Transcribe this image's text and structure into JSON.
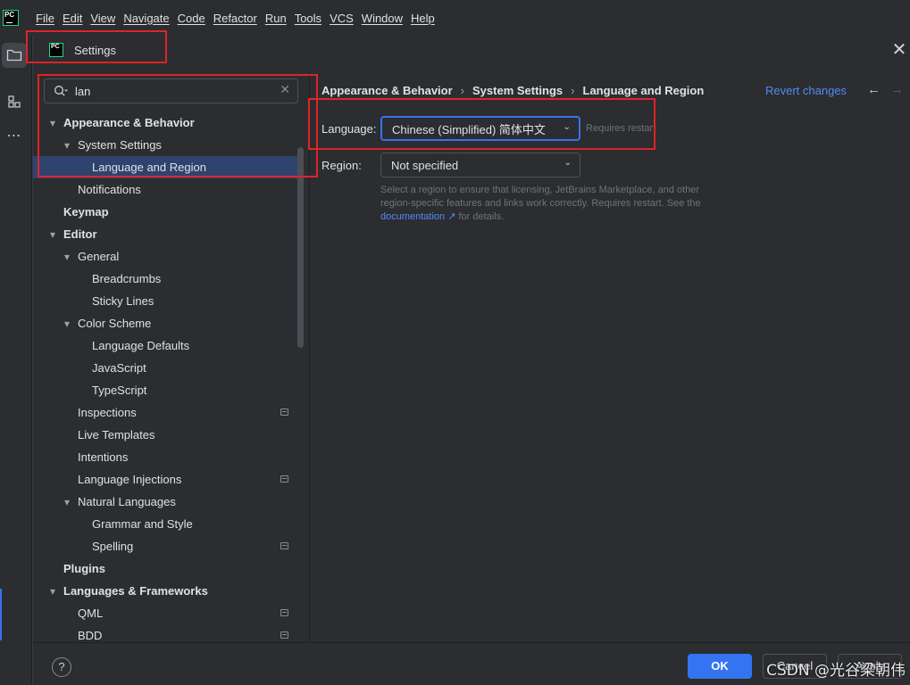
{
  "menubar": {
    "logo_text": "PC",
    "items": [
      "File",
      "Edit",
      "View",
      "Navigate",
      "Code",
      "Refactor",
      "Run",
      "Tools",
      "VCS",
      "Window",
      "Help"
    ]
  },
  "dialog": {
    "title": "Settings",
    "logo_text": "PC",
    "close_glyph": "✕"
  },
  "sidebar": {
    "search_value": "lan",
    "tree": [
      {
        "label": "Appearance & Behavior",
        "level": 0,
        "bold": true,
        "expander": "expanded"
      },
      {
        "label": "System Settings",
        "level": 1,
        "bold": false,
        "expander": "expanded"
      },
      {
        "label": "Language and Region",
        "level": 2,
        "bold": false,
        "expander": "none",
        "selected": true
      },
      {
        "label": "Notifications",
        "level": 1,
        "bold": false,
        "expander": "none"
      },
      {
        "label": "Keymap",
        "level": 0,
        "bold": true,
        "expander": "none"
      },
      {
        "label": "Editor",
        "level": 0,
        "bold": true,
        "expander": "expanded"
      },
      {
        "label": "General",
        "level": 1,
        "bold": false,
        "expander": "expanded"
      },
      {
        "label": "Breadcrumbs",
        "level": 2,
        "bold": false,
        "expander": "none"
      },
      {
        "label": "Sticky Lines",
        "level": 2,
        "bold": false,
        "expander": "none"
      },
      {
        "label": "Color Scheme",
        "level": 1,
        "bold": false,
        "expander": "expanded"
      },
      {
        "label": "Language Defaults",
        "level": 2,
        "bold": false,
        "expander": "none"
      },
      {
        "label": "JavaScript",
        "level": 2,
        "bold": false,
        "expander": "none"
      },
      {
        "label": "TypeScript",
        "level": 2,
        "bold": false,
        "expander": "none"
      },
      {
        "label": "Inspections",
        "level": 1,
        "bold": false,
        "expander": "none",
        "badge": true
      },
      {
        "label": "Live Templates",
        "level": 1,
        "bold": false,
        "expander": "none"
      },
      {
        "label": "Intentions",
        "level": 1,
        "bold": false,
        "expander": "none"
      },
      {
        "label": "Language Injections",
        "level": 1,
        "bold": false,
        "expander": "none",
        "badge": true
      },
      {
        "label": "Natural Languages",
        "level": 1,
        "bold": false,
        "expander": "expanded"
      },
      {
        "label": "Grammar and Style",
        "level": 2,
        "bold": false,
        "expander": "none"
      },
      {
        "label": "Spelling",
        "level": 2,
        "bold": false,
        "expander": "none",
        "badge": true
      },
      {
        "label": "Plugins",
        "level": 0,
        "bold": true,
        "expander": "none"
      },
      {
        "label": "Languages & Frameworks",
        "level": 0,
        "bold": true,
        "expander": "expanded"
      },
      {
        "label": "QML",
        "level": 1,
        "bold": false,
        "expander": "none",
        "badge": true
      },
      {
        "label": "BDD",
        "level": 1,
        "bold": false,
        "expander": "none",
        "badge": true
      }
    ]
  },
  "content": {
    "breadcrumb": [
      "Appearance & Behavior",
      "System Settings",
      "Language and Region"
    ],
    "revert_label": "Revert changes",
    "language_label": "Language:",
    "language_value": "Chinese (Simplified) 简体中文",
    "requires_restart": "Requires restart",
    "region_label": "Region:",
    "region_value": "Not specified",
    "region_help_1": "Select a region to ensure that licensing, JetBrains Marketplace, and other region-specific features and links work correctly. Requires restart. See the",
    "doc_link": "documentation ↗",
    "region_help_2": " for details."
  },
  "footer": {
    "help_label": "?",
    "ok_label": "OK",
    "cancel_label": "Cancel",
    "apply_label": "Apply"
  },
  "watermark": "CSDN @光谷梁朝伟",
  "colors": {
    "accent": "#3574f0",
    "selection": "#2e436e",
    "link": "#548af7",
    "annotation_red": "#e0232a"
  }
}
